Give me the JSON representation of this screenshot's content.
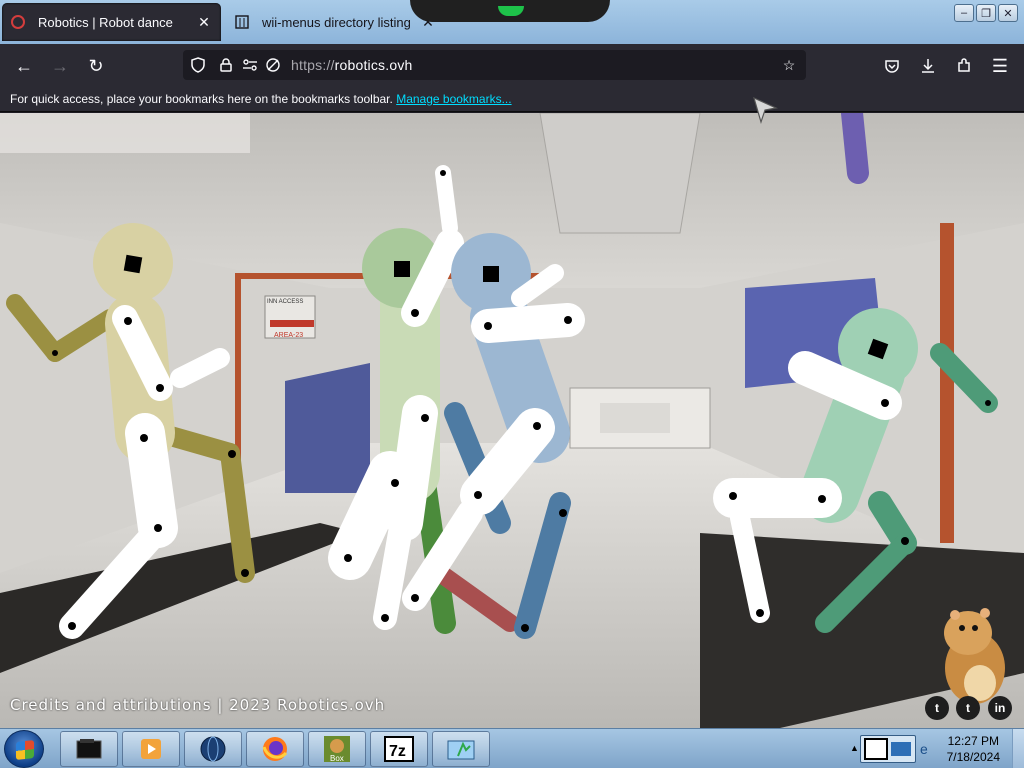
{
  "tabs": [
    {
      "title": "Robotics | Robot dance",
      "favicon": "robotics-favicon-icon",
      "active": true
    },
    {
      "title": "wii-menus directory listing",
      "favicon": "directory-icon",
      "active": false
    }
  ],
  "toolbar": {
    "back_icon": "←",
    "forward_icon": "→",
    "reload_icon": "↻",
    "url_scheme": "https://",
    "url_host": "robotics.ovh"
  },
  "bookmarks_bar": {
    "message": "For quick access, place your bookmarks here on the bookmarks toolbar.",
    "link": "Manage bookmarks..."
  },
  "page": {
    "credits": "Credits and attributions | 2023 Robotics.ovh",
    "sign_top": "INN ACCESS",
    "sign_bottom": "AREA-23",
    "social": [
      {
        "name": "twitter-icon",
        "glyph": "t"
      },
      {
        "name": "tumblr-icon",
        "glyph": "t"
      },
      {
        "name": "linkedin-icon",
        "glyph": "in"
      }
    ]
  },
  "taskbar": {
    "items": [
      "file-manager-icon",
      "media-player-icon",
      "globe-icon",
      "firefox-icon",
      "game-box-icon",
      "7zip-icon",
      "app-window-icon"
    ],
    "sevenzip_label": "7z",
    "box_label": "Box",
    "time": "12:27 PM",
    "date": "7/18/2024"
  },
  "colors": {
    "robot_khaki": "#d8d1a3",
    "robot_olive": "#9b9042",
    "robot_green": "#a9c99b",
    "robot_blue": "#9cb7d2",
    "robot_teal": "#9fd0b4",
    "limb_white": "#ffffff"
  }
}
